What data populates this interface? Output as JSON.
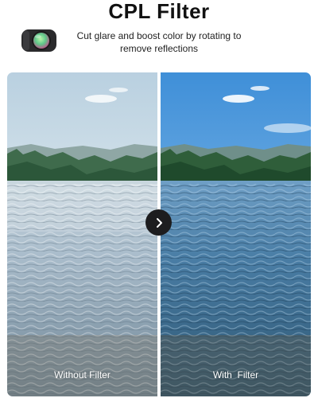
{
  "header": {
    "title": "CPL Filter",
    "subtitle": "Cut glare and boost color by rotating to remove reflections"
  },
  "icons": {
    "filter": "lens-filter-icon",
    "compare": "chevron-right-icon"
  },
  "comparison": {
    "left_label": "Without Filter",
    "right_label": "With  Filter"
  },
  "colors": {
    "left_sky": "#dfe9ee",
    "right_sky": "#4b95d8",
    "button": "#1d1d1f",
    "filter_glass": "#6fd08f"
  }
}
